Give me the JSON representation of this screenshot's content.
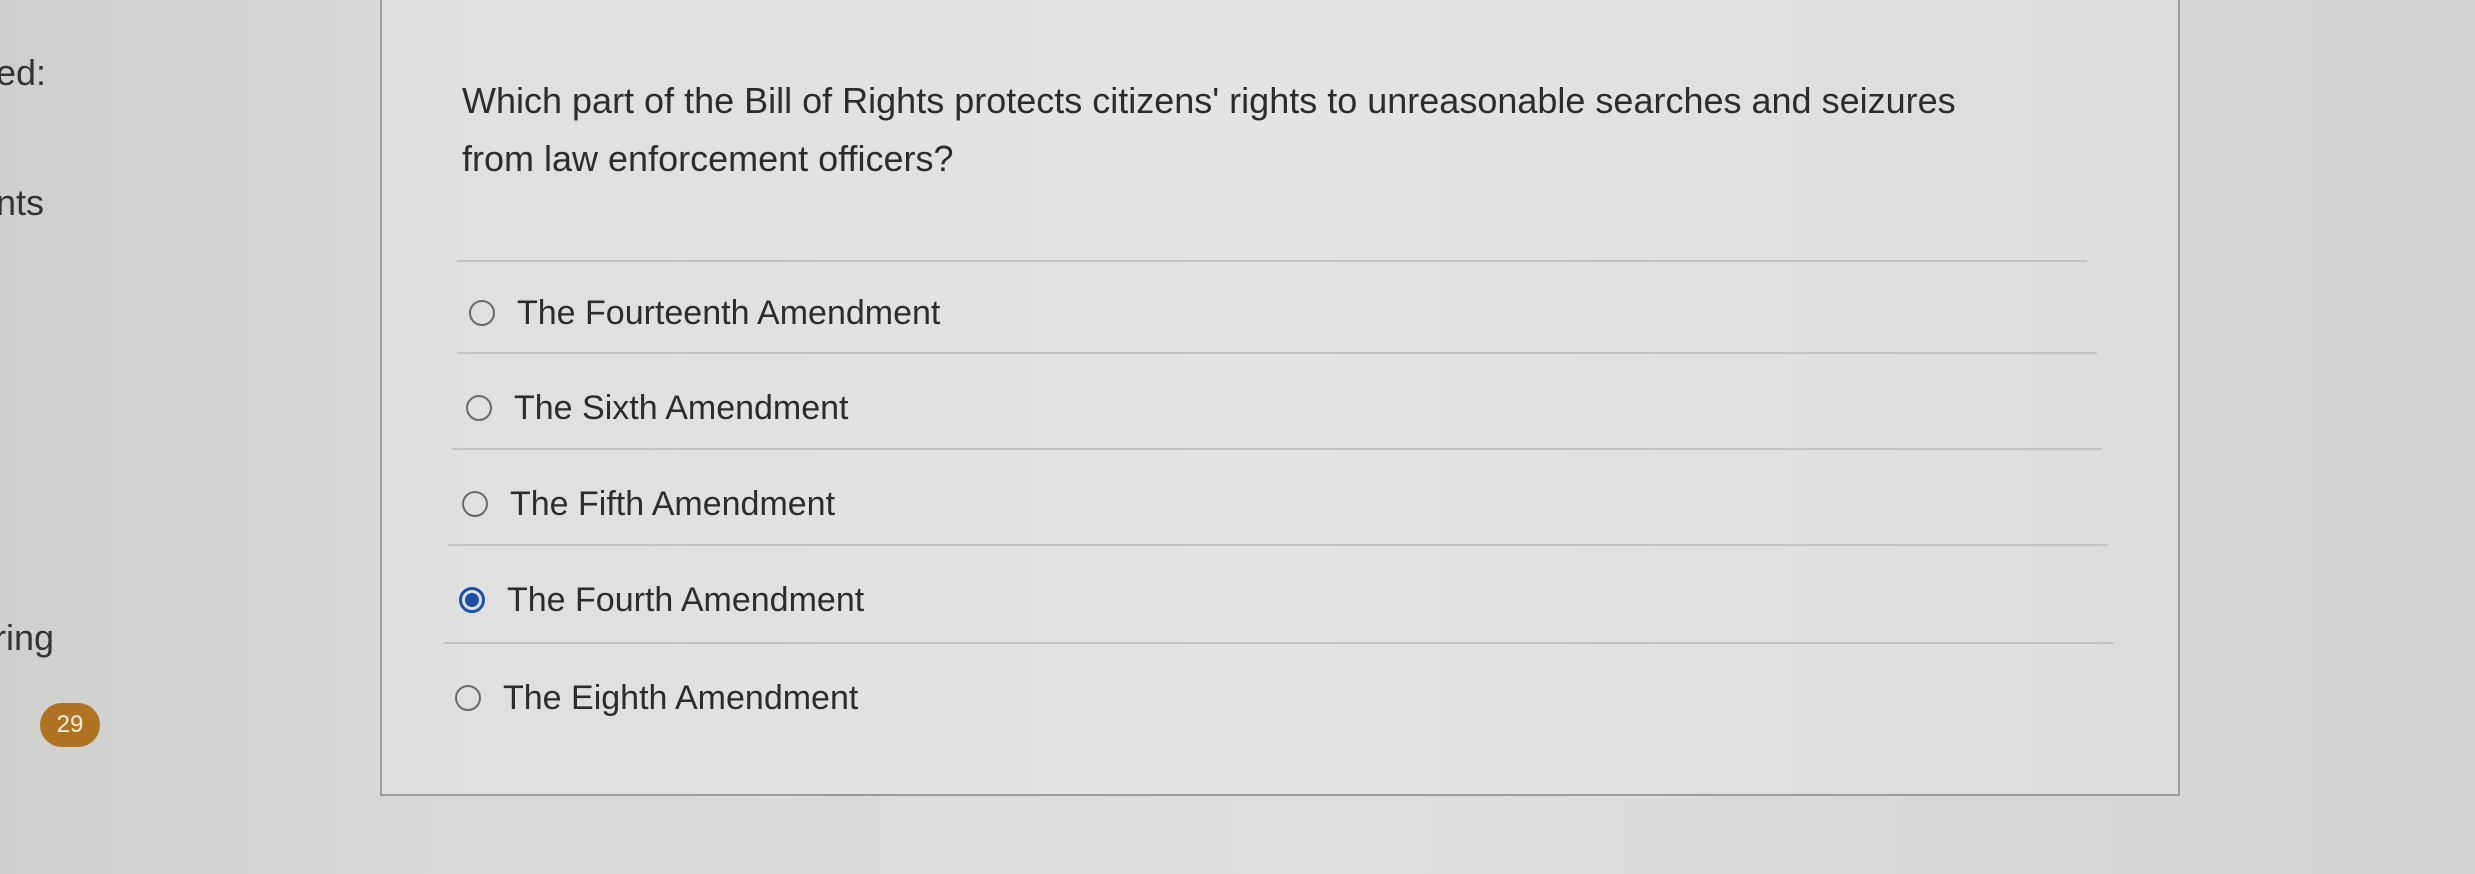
{
  "sidebar": {
    "labels": [
      "ed:",
      "nts",
      "ring"
    ],
    "badge": "29"
  },
  "question": {
    "text": "Which part of the Bill of Rights protects citizens' rights to unreasonable searches and seizures from law enforcement officers?",
    "options": [
      {
        "label": "The Fourteenth Amendment",
        "selected": false
      },
      {
        "label": "The Sixth Amendment",
        "selected": false
      },
      {
        "label": "The Fifth Amendment",
        "selected": false
      },
      {
        "label": "The Fourth Amendment",
        "selected": true
      },
      {
        "label": "The Eighth Amendment",
        "selected": false
      }
    ]
  },
  "colors": {
    "accent": "#1a4fa8",
    "badge": "#b07322"
  }
}
